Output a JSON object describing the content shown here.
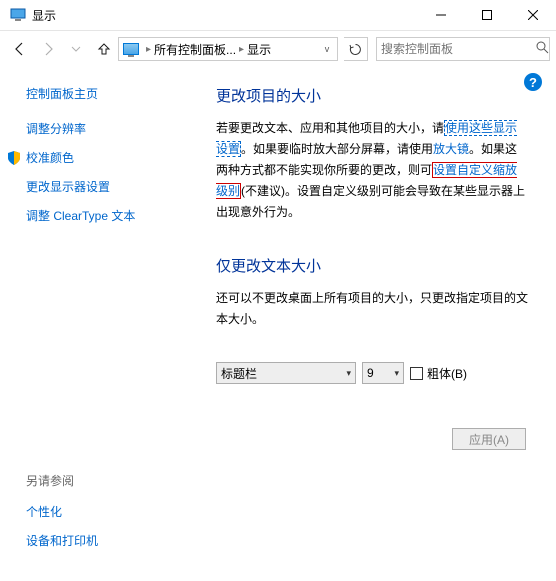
{
  "titlebar": {
    "title": "显示"
  },
  "nav": {
    "breadcrumb_root": "所有控制面板...",
    "breadcrumb_current": "显示",
    "search_placeholder": "搜索控制面板"
  },
  "sidebar": {
    "home": "控制面板主页",
    "links": [
      {
        "label": "调整分辨率",
        "shield": false
      },
      {
        "label": "校准颜色",
        "shield": true
      },
      {
        "label": "更改显示器设置",
        "shield": false
      },
      {
        "label": "调整 ClearType 文本",
        "shield": false
      }
    ],
    "see_also_header": "另请参阅",
    "see_also": [
      {
        "label": "个性化"
      },
      {
        "label": "设备和打印机"
      }
    ]
  },
  "main": {
    "section1_title": "更改项目的大小",
    "p1_a": "若要更改文本、应用和其他项目的大小，请",
    "p1_link1": "使用这些显示设置",
    "p1_b": "。如果要临时放大部分屏幕，请使用",
    "p1_link2": "放大镜",
    "p1_c": "。如果这两种方式都不能实现你所要的更改，则可",
    "p1_link3": "设置自定义缩放级别",
    "p1_d": "(不建议)。设置自定义级别可能会导致在某些显示器上出现意外行为。",
    "section2_title": "仅更改文本大小",
    "p2": "还可以不更改桌面上所有项目的大小，只更改指定项目的文本大小。",
    "dropdown_item": "标题栏",
    "dropdown_size": "9",
    "checkbox_bold": "粗体(B)",
    "apply_button": "应用(A)"
  }
}
